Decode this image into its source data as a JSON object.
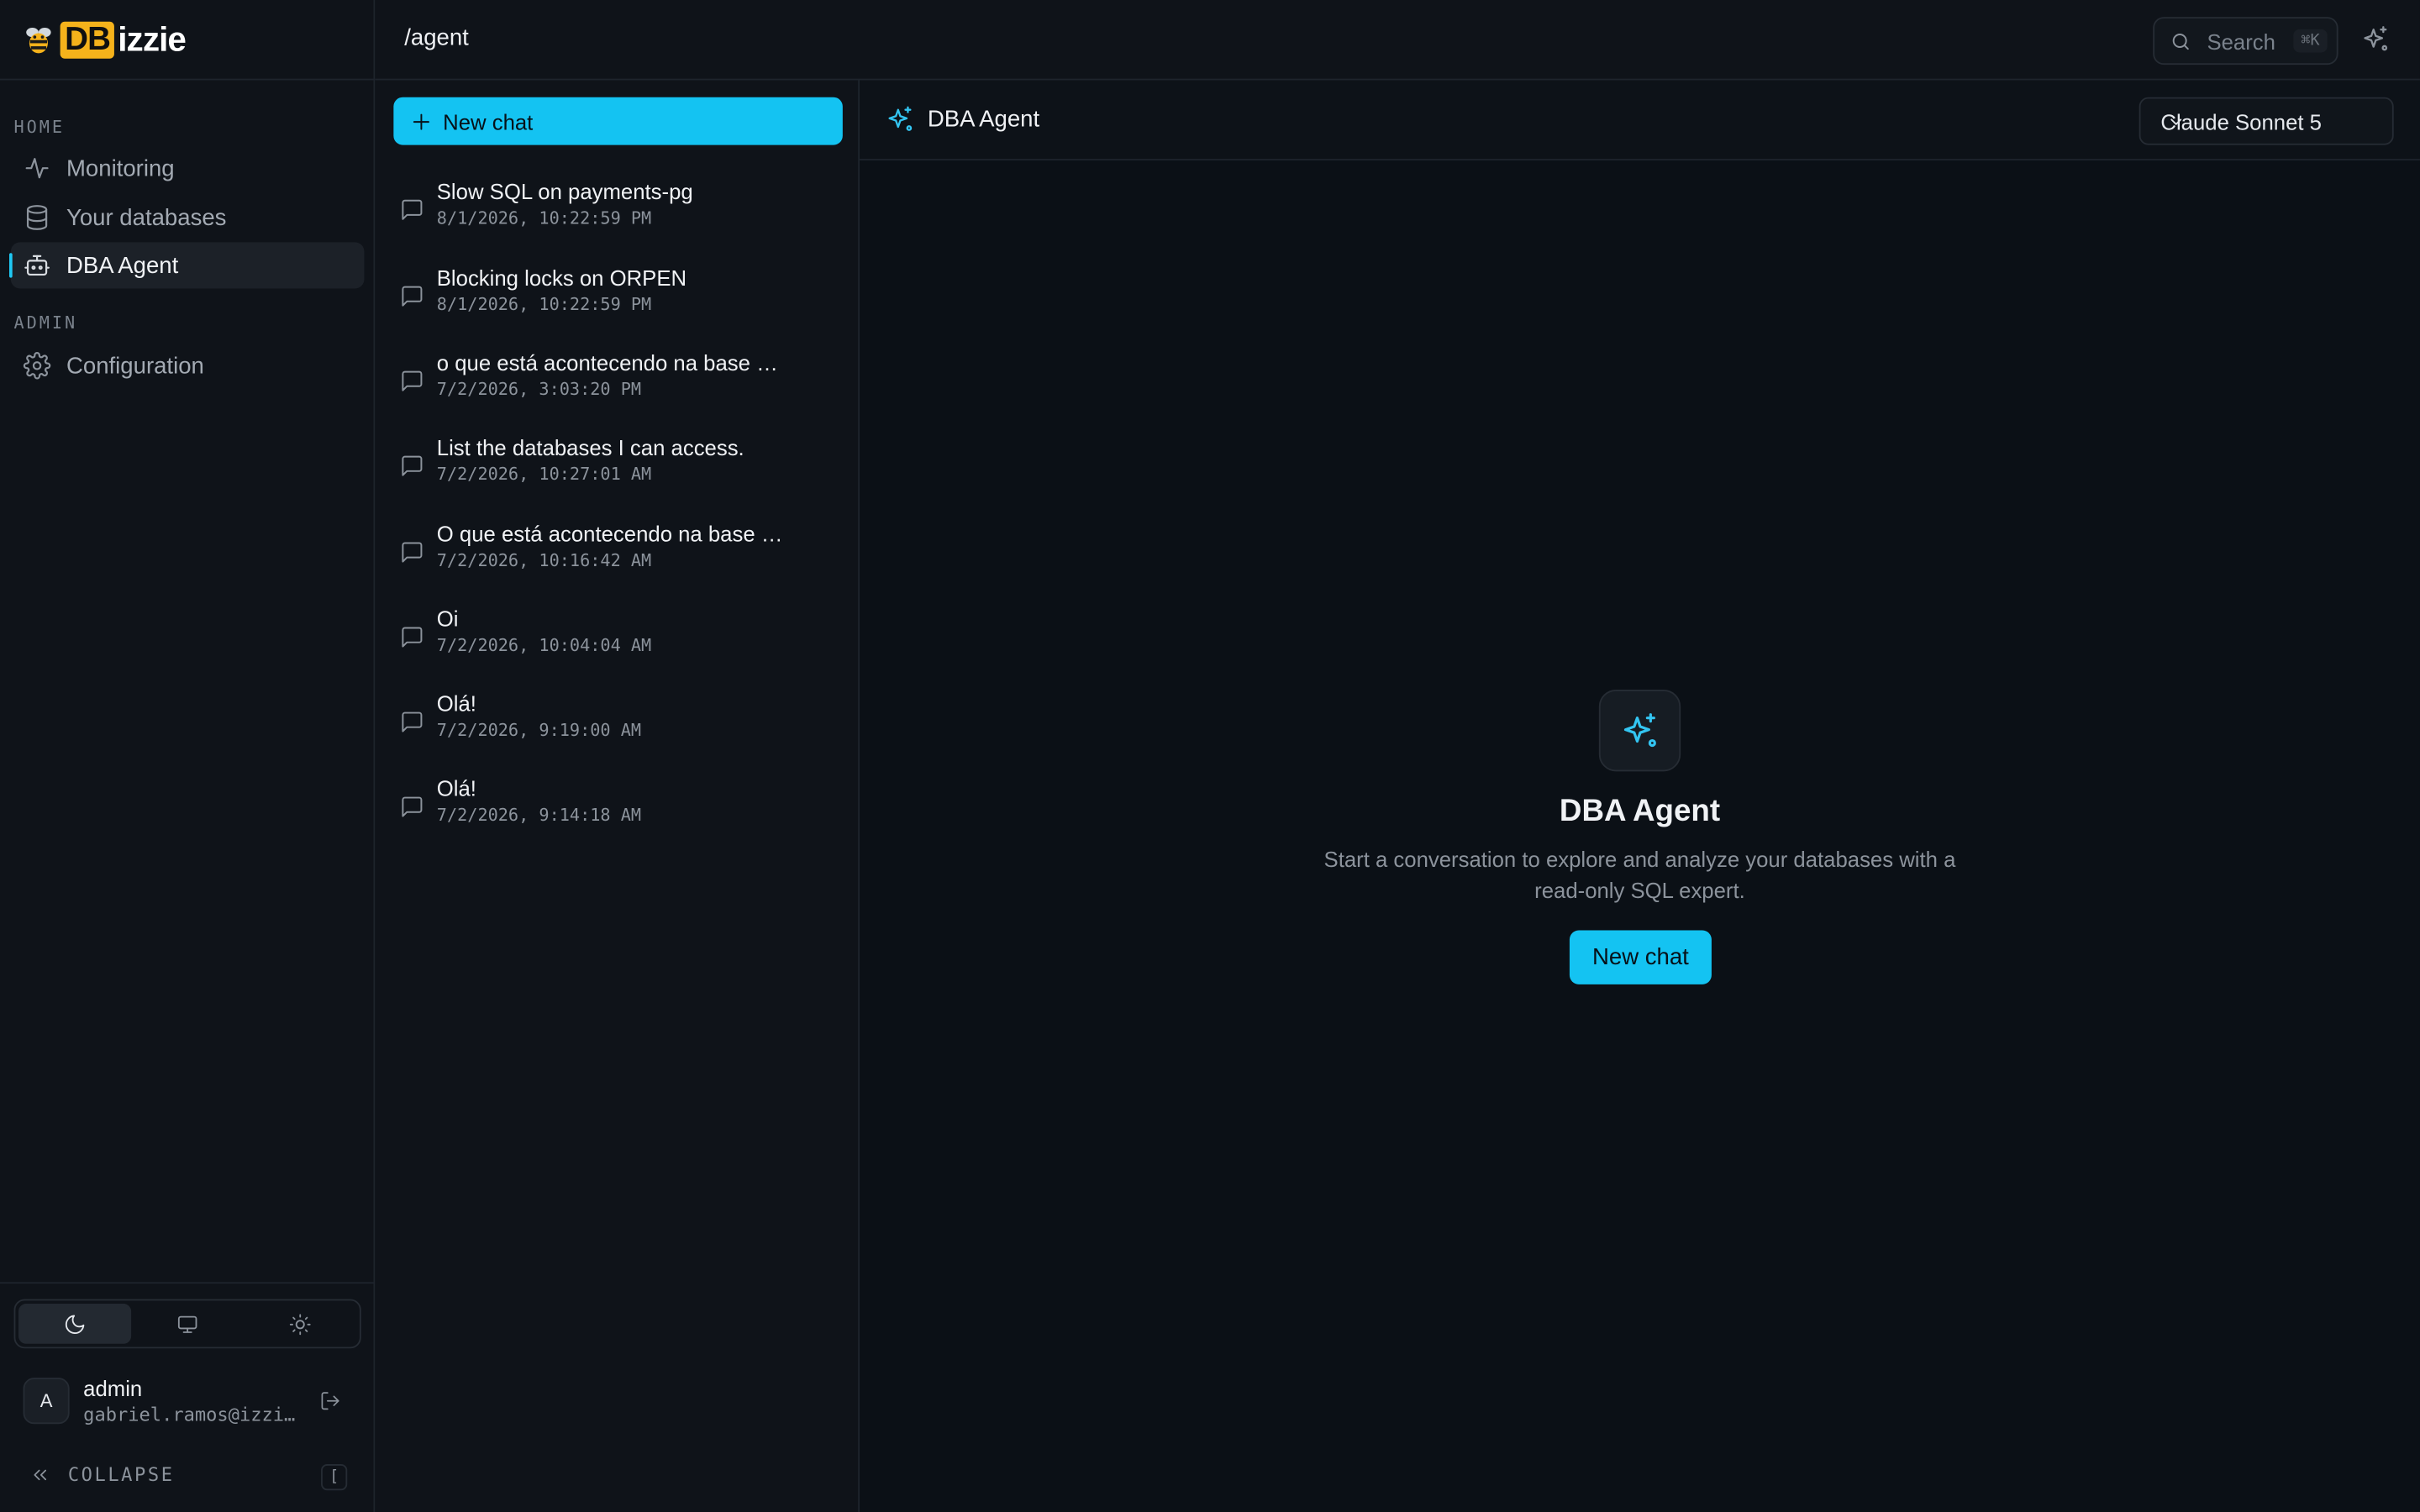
{
  "brand": {
    "logo_db": "DB",
    "logo_izzie": "izzie"
  },
  "sidebar": {
    "sections": [
      {
        "label": "HOME"
      },
      {
        "label": "ADMIN"
      }
    ],
    "items": [
      {
        "label": "Monitoring",
        "icon": "activity-icon"
      },
      {
        "label": "Your databases",
        "icon": "database-icon"
      },
      {
        "label": "DBA Agent",
        "icon": "bot-icon",
        "active": true
      },
      {
        "label": "Configuration",
        "icon": "gear-icon"
      }
    ],
    "theme": {
      "options": [
        "moon-icon",
        "monitor-icon",
        "sun-icon"
      ],
      "selected": "moon-icon"
    },
    "user": {
      "avatar_initial": "A",
      "name": "admin",
      "email": "gabriel.ramos@izzie…"
    },
    "collapse_label": "COLLAPSE",
    "collapse_key": "["
  },
  "topbar": {
    "route": "/agent",
    "search": {
      "label": "Search",
      "shortcut": "⌘K"
    }
  },
  "chatlist": {
    "new_chat_label": "New chat",
    "chats": [
      {
        "title": "Slow SQL on payments-pg",
        "date": "8/1/2026, 10:22:59 PM"
      },
      {
        "title": "Blocking locks on ORPEN",
        "date": "8/1/2026, 10:22:59 PM"
      },
      {
        "title": "o que está acontecendo na base …",
        "date": "7/2/2026, 3:03:20 PM"
      },
      {
        "title": "List the databases I can access.",
        "date": "7/2/2026, 10:27:01 AM"
      },
      {
        "title": "O que está acontecendo na base …",
        "date": "7/2/2026, 10:16:42 AM"
      },
      {
        "title": "Oi",
        "date": "7/2/2026, 10:04:04 AM"
      },
      {
        "title": "Olá!",
        "date": "7/2/2026, 9:19:00 AM"
      },
      {
        "title": "Olá!",
        "date": "7/2/2026, 9:14:18 AM"
      }
    ]
  },
  "main": {
    "title": "DBA Agent",
    "model_select": "Claude Sonnet 5",
    "empty": {
      "title": "DBA Agent",
      "description": "Start a conversation to explore and analyze your databases with a read-only SQL expert.",
      "button": "New chat"
    }
  },
  "colors": {
    "accent": "#14c3f2",
    "brand": "#f5b21b",
    "background": "#0b1016",
    "panel": "#0f1319"
  }
}
